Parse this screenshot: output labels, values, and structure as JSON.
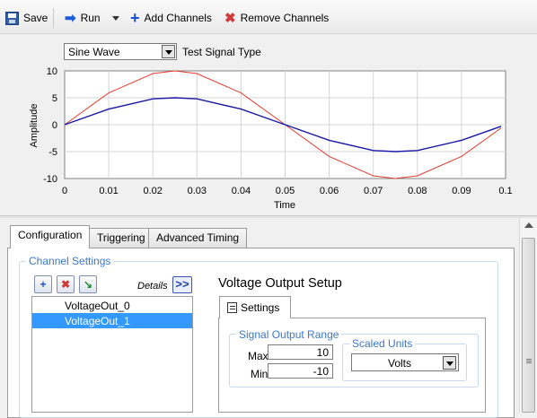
{
  "toolbar": {
    "save_label": "Save",
    "run_label": "Run",
    "add_channels_label": "Add Channels",
    "remove_channels_label": "Remove Channels"
  },
  "signal_select": {
    "value": "Sine Wave",
    "label": "Test Signal Type"
  },
  "chart_data": {
    "type": "line",
    "title": "",
    "xlabel": "Time",
    "ylabel": "Amplitude",
    "xlim": [
      0,
      0.1
    ],
    "ylim": [
      -10,
      10
    ],
    "x_ticks": [
      "0",
      "0.01",
      "0.02",
      "0.03",
      "0.04",
      "0.05",
      "0.06",
      "0.07",
      "0.08",
      "0.09",
      "0.1"
    ],
    "y_ticks": [
      "10",
      "5",
      "0",
      "-5",
      "-10"
    ],
    "grid": true,
    "x": [
      0,
      0.01,
      0.02,
      0.025,
      0.03,
      0.04,
      0.05,
      0.06,
      0.07,
      0.075,
      0.08,
      0.09,
      0.099
    ],
    "series": [
      {
        "color": "#e03c31",
        "values": [
          0,
          5.9,
          9.5,
          10,
          9.5,
          5.9,
          0,
          -5.9,
          -9.5,
          -10,
          -9.5,
          -5.9,
          -0.6
        ]
      },
      {
        "color": "#1a1aa6",
        "values": [
          0,
          2.9,
          4.8,
          5,
          4.8,
          2.9,
          0,
          -2.9,
          -4.8,
          -5,
          -4.8,
          -2.9,
          -0.3
        ]
      }
    ]
  },
  "tabs": [
    "Configuration",
    "Triggering",
    "Advanced Timing"
  ],
  "channel_settings": {
    "legend": "Channel Settings",
    "details_label": "Details",
    "expand_label": ">>",
    "channels": [
      "VoltageOut_0",
      "VoltageOut_1"
    ],
    "selected_index": 1
  },
  "setup": {
    "title": "Voltage Output Setup",
    "settings_tab": "Settings",
    "range_legend": "Signal Output Range",
    "max_label": "Max",
    "max_value": "10",
    "min_label": "Min",
    "min_value": "-10",
    "scaled_units_legend": "Scaled Units",
    "scaled_units_value": "Volts"
  },
  "colors": {
    "accent": "#3399ff",
    "legend_text": "#3b77c7"
  }
}
